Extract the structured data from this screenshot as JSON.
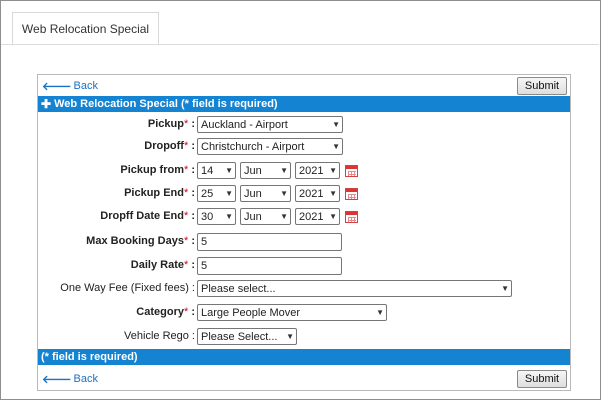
{
  "tab": {
    "label": "Web Relocation Special"
  },
  "toolbar": {
    "back_label": "Back",
    "submit_label": "Submit"
  },
  "form": {
    "header": "Web Relocation Special (* field is required)",
    "footer": "(* field is required)",
    "req_mark": "*",
    "fields": {
      "pickup": {
        "label": "Pickup",
        "value": "Auckland - Airport"
      },
      "dropoff": {
        "label": "Dropoff",
        "value": "Christchurch - Airport"
      },
      "pickup_from": {
        "label": "Pickup from",
        "day": "14",
        "month": "Jun",
        "year": "2021"
      },
      "pickup_end": {
        "label": "Pickup End",
        "day": "25",
        "month": "Jun",
        "year": "2021"
      },
      "dropoff_date_end": {
        "label": "Dropff Date End",
        "day": "30",
        "month": "Jun",
        "year": "2021"
      },
      "max_booking_days": {
        "label": "Max Booking Days",
        "value": "5"
      },
      "daily_rate": {
        "label": "Daily Rate",
        "value": "5"
      },
      "one_way_fee": {
        "label": "One Way Fee (Fixed fees)",
        "value": "Please select..."
      },
      "category": {
        "label": "Category",
        "value": "Large People Mover"
      },
      "vehicle_rego": {
        "label": "Vehicle Rego",
        "value": "Please Select..."
      }
    }
  },
  "colors": {
    "accent": "#1483d1",
    "required": "#d0021b",
    "link": "#1a72c4"
  },
  "icons": {
    "back": "arrow-left-icon",
    "plus": "plus-icon",
    "calendar": "calendar-icon",
    "dropdown": "chevron-down-icon"
  }
}
